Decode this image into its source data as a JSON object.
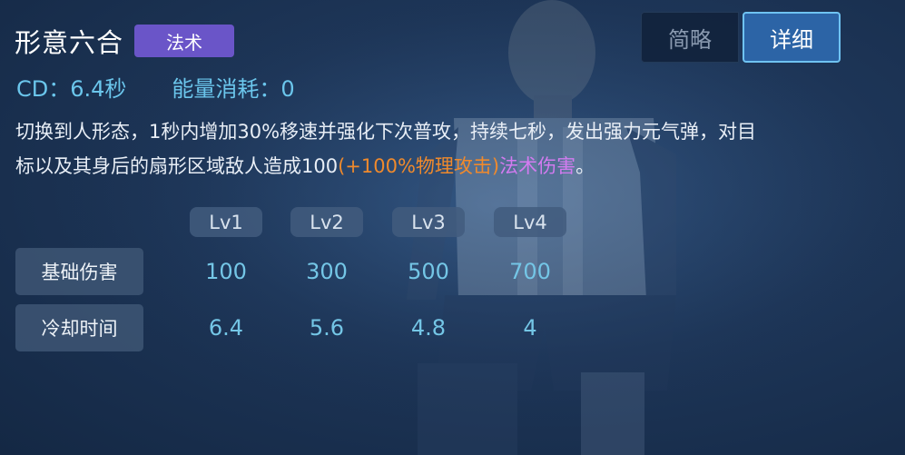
{
  "skill": {
    "name": "形意六合",
    "type_badge": "法术",
    "cd_text": "CD：6.4秒",
    "energy_text": "能量消耗：0",
    "description": {
      "line1": "切换到人形态，1秒内增加30%移速并强化下次普攻，持续七秒，发出强力元气弹，对目",
      "line2_prefix": "标以及其身后的扇形区域敌人造成100",
      "line2_scaling": "(+100%物理攻击)",
      "line2_damage": "法术伤害",
      "line2_suffix": "。"
    }
  },
  "view_toggle": {
    "brief_label": "简略",
    "detail_label": "详细",
    "selected": "详细"
  },
  "level_table": {
    "headers": [
      "Lv1",
      "Lv2",
      "Lv3",
      "Lv4"
    ],
    "rows": [
      {
        "label": "基础伤害",
        "values": [
          "100",
          "300",
          "500",
          "700"
        ]
      },
      {
        "label": "冷却时间",
        "values": [
          "6.4",
          "5.6",
          "4.8",
          "4"
        ]
      }
    ]
  },
  "colors": {
    "stat_text": "#6bc6ec",
    "scaling_text": "#f08a2c",
    "damage_type_text": "#d27bf0",
    "badge_bg": "#6a55c8",
    "selected_tab": "#2c64a6"
  }
}
